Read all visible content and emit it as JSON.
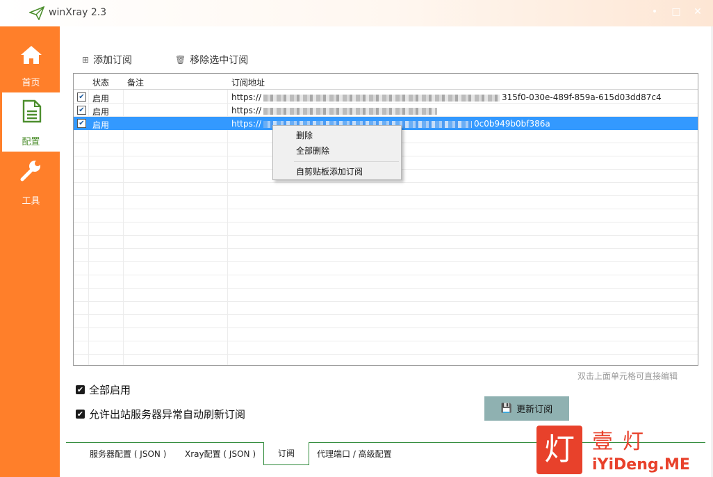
{
  "window": {
    "title": "winXray 2.3",
    "controls": [
      "•",
      "□",
      "✕"
    ]
  },
  "sidebar": {
    "items": [
      {
        "label": "首页",
        "icon": "home-icon"
      },
      {
        "label": "配置",
        "icon": "document-icon",
        "active": true
      },
      {
        "label": "工具",
        "icon": "wrench-icon"
      }
    ]
  },
  "toolbar": {
    "add_label": "添加订阅",
    "remove_label": "移除选中订阅"
  },
  "grid": {
    "columns": [
      "状态",
      "备注",
      "订阅地址"
    ],
    "rows": [
      {
        "checked": true,
        "status": "启用",
        "remark": "",
        "url_prefix": "https://",
        "url_suffix": "315f0-030e-489f-859a-615d03dd87c4"
      },
      {
        "checked": true,
        "status": "启用",
        "remark": "",
        "url_prefix": "https://",
        "url_suffix": ""
      },
      {
        "checked": true,
        "status": "启用",
        "remark": "",
        "url_prefix": "https://",
        "url_suffix": "0c0b949b0bf386a",
        "selected": true
      }
    ]
  },
  "context_menu": {
    "items": [
      "删除",
      "全部删除",
      "自剪贴板添加订阅"
    ]
  },
  "hint": "双击上面单元格可直接编辑",
  "options": {
    "enable_all": "全部启用",
    "auto_refresh": "允许出站服务器异常自动刷新订阅"
  },
  "update_button": "更新订阅",
  "tabs": [
    "服务器配置 ( JSON )",
    "Xray配置 ( JSON )",
    "订阅",
    "代理端口 / 高级配置"
  ],
  "watermark": {
    "seal": "灯",
    "title": "壹灯",
    "site": "iYiDeng.ME"
  },
  "colors": {
    "sidebar": "#ff7f2a",
    "active_icon": "#4c8e2d",
    "selection": "#3399ff",
    "update_button": "#8fb1b1",
    "tab_line": "#2f8a3a"
  }
}
